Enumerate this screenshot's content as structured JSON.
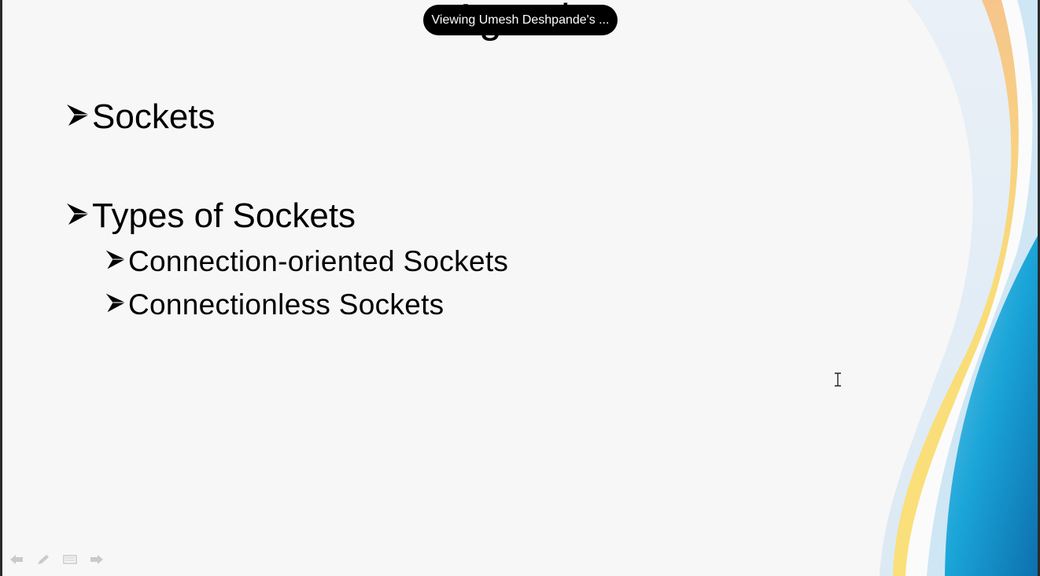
{
  "banner": {
    "text": "Viewing Umesh Deshpande's ..."
  },
  "slide": {
    "title": "Agenda",
    "bullets": [
      {
        "text": "Sockets",
        "level": 1
      },
      {
        "text": "Types of Sockets",
        "level": 1
      },
      {
        "text": "Connection-oriented Sockets",
        "level": 2
      },
      {
        "text": "Connectionless Sockets",
        "level": 2
      }
    ]
  },
  "controls": {
    "icons": [
      "previous-slide-icon",
      "pen-icon",
      "slide-menu-icon",
      "next-slide-icon"
    ]
  },
  "colors": {
    "background": "#f7f7f8",
    "wave_blue": "#1aa0d4",
    "wave_yellow": "#f8d66a",
    "wave_orange": "#f5c58f",
    "banner": "#000000"
  }
}
